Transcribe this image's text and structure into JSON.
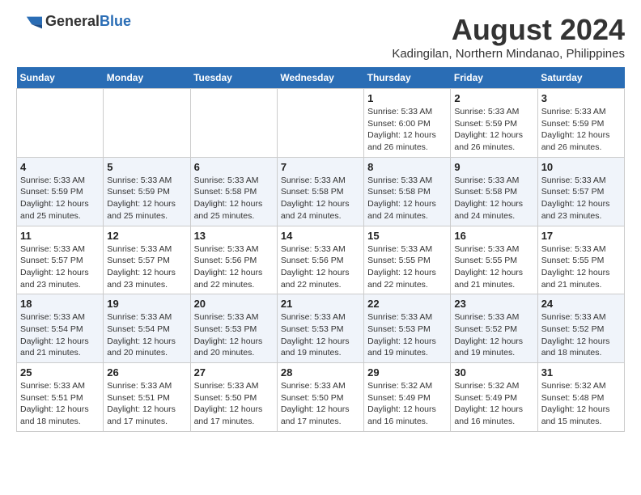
{
  "header": {
    "logo_general": "General",
    "logo_blue": "Blue",
    "month_year": "August 2024",
    "location": "Kadingilan, Northern Mindanao, Philippines"
  },
  "days_of_week": [
    "Sunday",
    "Monday",
    "Tuesday",
    "Wednesday",
    "Thursday",
    "Friday",
    "Saturday"
  ],
  "weeks": [
    [
      {
        "day": "",
        "info": ""
      },
      {
        "day": "",
        "info": ""
      },
      {
        "day": "",
        "info": ""
      },
      {
        "day": "",
        "info": ""
      },
      {
        "day": "1",
        "info": "Sunrise: 5:33 AM\nSunset: 6:00 PM\nDaylight: 12 hours and 26 minutes."
      },
      {
        "day": "2",
        "info": "Sunrise: 5:33 AM\nSunset: 5:59 PM\nDaylight: 12 hours and 26 minutes."
      },
      {
        "day": "3",
        "info": "Sunrise: 5:33 AM\nSunset: 5:59 PM\nDaylight: 12 hours and 26 minutes."
      }
    ],
    [
      {
        "day": "4",
        "info": "Sunrise: 5:33 AM\nSunset: 5:59 PM\nDaylight: 12 hours and 25 minutes."
      },
      {
        "day": "5",
        "info": "Sunrise: 5:33 AM\nSunset: 5:59 PM\nDaylight: 12 hours and 25 minutes."
      },
      {
        "day": "6",
        "info": "Sunrise: 5:33 AM\nSunset: 5:58 PM\nDaylight: 12 hours and 25 minutes."
      },
      {
        "day": "7",
        "info": "Sunrise: 5:33 AM\nSunset: 5:58 PM\nDaylight: 12 hours and 24 minutes."
      },
      {
        "day": "8",
        "info": "Sunrise: 5:33 AM\nSunset: 5:58 PM\nDaylight: 12 hours and 24 minutes."
      },
      {
        "day": "9",
        "info": "Sunrise: 5:33 AM\nSunset: 5:58 PM\nDaylight: 12 hours and 24 minutes."
      },
      {
        "day": "10",
        "info": "Sunrise: 5:33 AM\nSunset: 5:57 PM\nDaylight: 12 hours and 23 minutes."
      }
    ],
    [
      {
        "day": "11",
        "info": "Sunrise: 5:33 AM\nSunset: 5:57 PM\nDaylight: 12 hours and 23 minutes."
      },
      {
        "day": "12",
        "info": "Sunrise: 5:33 AM\nSunset: 5:57 PM\nDaylight: 12 hours and 23 minutes."
      },
      {
        "day": "13",
        "info": "Sunrise: 5:33 AM\nSunset: 5:56 PM\nDaylight: 12 hours and 22 minutes."
      },
      {
        "day": "14",
        "info": "Sunrise: 5:33 AM\nSunset: 5:56 PM\nDaylight: 12 hours and 22 minutes."
      },
      {
        "day": "15",
        "info": "Sunrise: 5:33 AM\nSunset: 5:55 PM\nDaylight: 12 hours and 22 minutes."
      },
      {
        "day": "16",
        "info": "Sunrise: 5:33 AM\nSunset: 5:55 PM\nDaylight: 12 hours and 21 minutes."
      },
      {
        "day": "17",
        "info": "Sunrise: 5:33 AM\nSunset: 5:55 PM\nDaylight: 12 hours and 21 minutes."
      }
    ],
    [
      {
        "day": "18",
        "info": "Sunrise: 5:33 AM\nSunset: 5:54 PM\nDaylight: 12 hours and 21 minutes."
      },
      {
        "day": "19",
        "info": "Sunrise: 5:33 AM\nSunset: 5:54 PM\nDaylight: 12 hours and 20 minutes."
      },
      {
        "day": "20",
        "info": "Sunrise: 5:33 AM\nSunset: 5:53 PM\nDaylight: 12 hours and 20 minutes."
      },
      {
        "day": "21",
        "info": "Sunrise: 5:33 AM\nSunset: 5:53 PM\nDaylight: 12 hours and 19 minutes."
      },
      {
        "day": "22",
        "info": "Sunrise: 5:33 AM\nSunset: 5:53 PM\nDaylight: 12 hours and 19 minutes."
      },
      {
        "day": "23",
        "info": "Sunrise: 5:33 AM\nSunset: 5:52 PM\nDaylight: 12 hours and 19 minutes."
      },
      {
        "day": "24",
        "info": "Sunrise: 5:33 AM\nSunset: 5:52 PM\nDaylight: 12 hours and 18 minutes."
      }
    ],
    [
      {
        "day": "25",
        "info": "Sunrise: 5:33 AM\nSunset: 5:51 PM\nDaylight: 12 hours and 18 minutes."
      },
      {
        "day": "26",
        "info": "Sunrise: 5:33 AM\nSunset: 5:51 PM\nDaylight: 12 hours and 17 minutes."
      },
      {
        "day": "27",
        "info": "Sunrise: 5:33 AM\nSunset: 5:50 PM\nDaylight: 12 hours and 17 minutes."
      },
      {
        "day": "28",
        "info": "Sunrise: 5:33 AM\nSunset: 5:50 PM\nDaylight: 12 hours and 17 minutes."
      },
      {
        "day": "29",
        "info": "Sunrise: 5:32 AM\nSunset: 5:49 PM\nDaylight: 12 hours and 16 minutes."
      },
      {
        "day": "30",
        "info": "Sunrise: 5:32 AM\nSunset: 5:49 PM\nDaylight: 12 hours and 16 minutes."
      },
      {
        "day": "31",
        "info": "Sunrise: 5:32 AM\nSunset: 5:48 PM\nDaylight: 12 hours and 15 minutes."
      }
    ]
  ]
}
